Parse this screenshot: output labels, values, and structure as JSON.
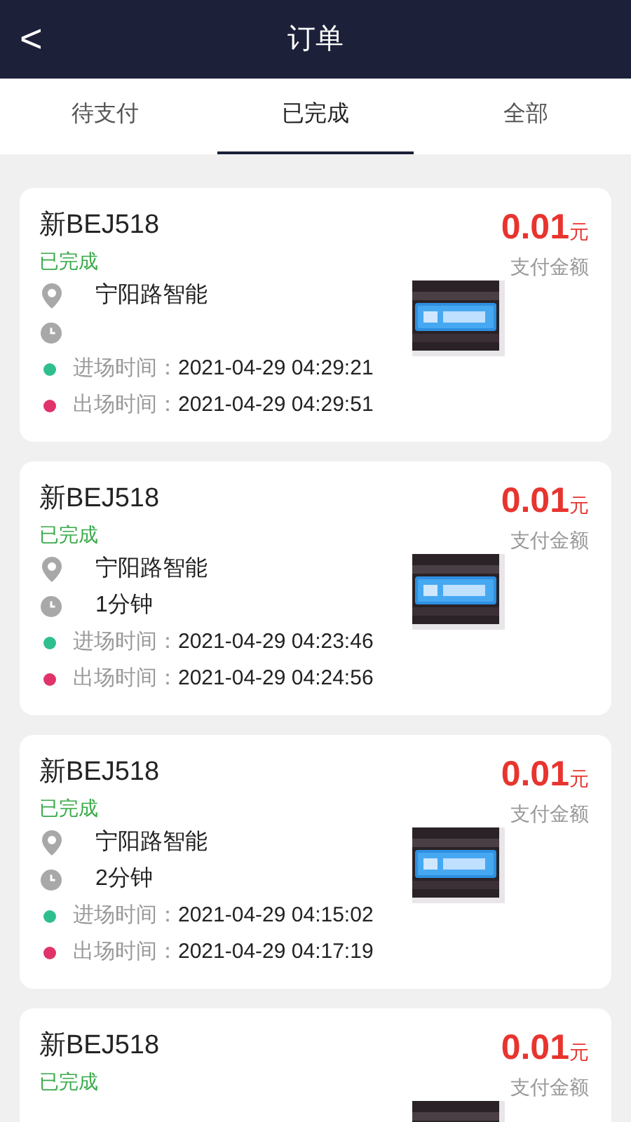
{
  "header": {
    "back": "<",
    "title": "订单"
  },
  "tabs": [
    {
      "label": "待支付",
      "selected": false
    },
    {
      "label": "已完成",
      "selected": true
    },
    {
      "label": "全部",
      "selected": false
    }
  ],
  "orders": [
    {
      "plate": "新BEJ518",
      "status": "已完成",
      "amount": "0.01",
      "currency": "元",
      "amount_label": "支付金额",
      "location": "宁阳路智能",
      "entry_label": "进场时间：",
      "entry_time": "2021-04-29 04:29:21",
      "exit_label": "出场时间：",
      "exit_time": "2021-04-29 04:29:51"
    },
    {
      "plate": "新BEJ518",
      "status": "已完成",
      "amount": "0.01",
      "currency": "元",
      "amount_label": "支付金额",
      "location": "宁阳路智能",
      "duration": "1分钟",
      "entry_label": "进场时间：",
      "entry_time": "2021-04-29 04:23:46",
      "exit_label": "出场时间：",
      "exit_time": "2021-04-29 04:24:56"
    },
    {
      "plate": "新BEJ518",
      "status": "已完成",
      "amount": "0.01",
      "currency": "元",
      "amount_label": "支付金额",
      "location": "宁阳路智能",
      "duration": "2分钟",
      "entry_label": "进场时间：",
      "entry_time": "2021-04-29 04:15:02",
      "exit_label": "出场时间：",
      "exit_time": "2021-04-29 04:17:19"
    },
    {
      "plate": "新BEJ518",
      "status": "已完成",
      "amount": "0.01",
      "currency": "元",
      "amount_label": "支付金额"
    }
  ]
}
